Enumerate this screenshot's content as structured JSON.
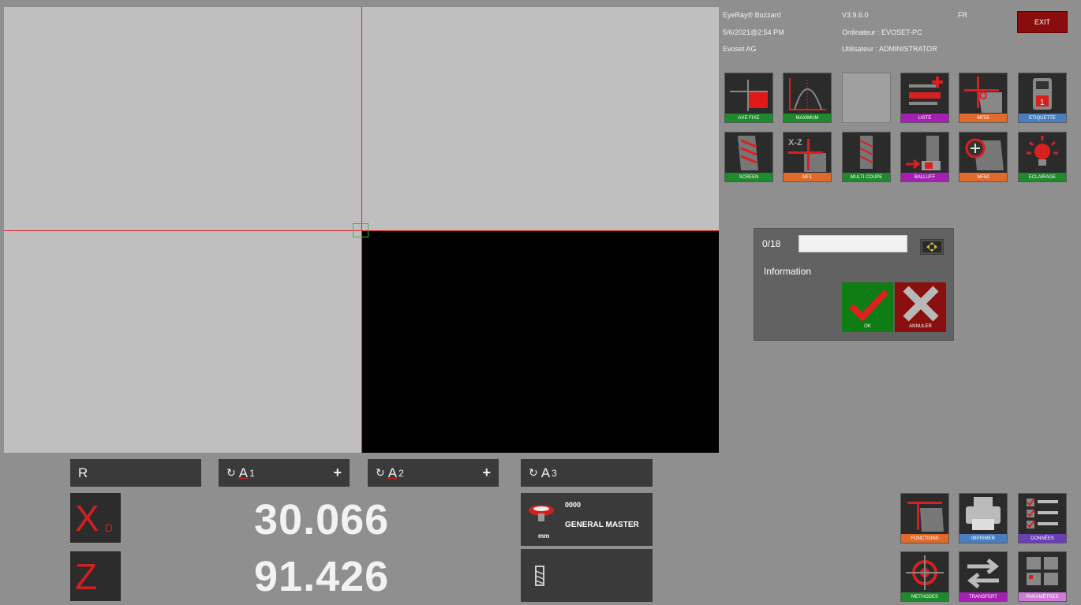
{
  "header": {
    "app_name": "EyeRay® Buzzard",
    "datetime": "5/6/2021@2:54 PM",
    "company": "Evoset AG",
    "version": "V3.9.6.0",
    "computer": "Ordinateur : EVOSET-PC",
    "user": "Utilisateur : ADMINISTRATOR",
    "language": "FR",
    "exit_label": "EXIT"
  },
  "tools_row1": [
    {
      "label": "AXE FIXE",
      "color": "#1d8a2b",
      "icon": "axe-fixe-icon"
    },
    {
      "label": "MAXIMUM",
      "color": "#1d8a2b",
      "icon": "maximum-icon"
    },
    {
      "label": "",
      "color": "",
      "icon": ""
    },
    {
      "label": "LISTE",
      "color": "#a51fb3",
      "icon": "liste-icon"
    },
    {
      "label": "MF55",
      "color": "#e06a2a",
      "icon": "mf55-icon"
    },
    {
      "label": "ETIQUETTE",
      "color": "#4a7fbf",
      "icon": "etiquette-icon"
    }
  ],
  "tools_row2": [
    {
      "label": "SCREEN",
      "color": "#1d8a2b",
      "icon": "screen-icon"
    },
    {
      "label": "MF1",
      "color": "#e06a2a",
      "icon": "mf1-icon"
    },
    {
      "label": "MULTI COUPE",
      "color": "#1d8a2b",
      "icon": "multi-coupe-icon"
    },
    {
      "label": "BALLUFF",
      "color": "#a51fb3",
      "icon": "balluff-icon"
    },
    {
      "label": "MF50",
      "color": "#e06a2a",
      "icon": "mf50-icon"
    },
    {
      "label": "ECLAIRAGE",
      "color": "#1d8a2b",
      "icon": "eclairage-icon"
    }
  ],
  "dialog": {
    "counter": "0/18",
    "input_value": "",
    "info_label": "Information",
    "ok_label": "OK",
    "cancel_label": "ANNULER"
  },
  "dro": {
    "r_label": "R",
    "a1_label": "A",
    "a1_sub": "1",
    "a2_label": "A",
    "a2_sub": "2",
    "a3_label": "A",
    "a3_sub": "3",
    "x_letter": "X",
    "x_sub": "D",
    "x_value": "30.066",
    "z_letter": "Z",
    "z_value": "91.426",
    "tool_number": "0000",
    "tool_name": "GENERAL MASTER",
    "unit": "mm"
  },
  "bottom_buttons": [
    {
      "label": "FONCTIONS",
      "color": "#e06a2a",
      "icon": "fonctions-icon"
    },
    {
      "label": "IMPRIMER",
      "color": "#4a7fbf",
      "icon": "printer-icon"
    },
    {
      "label": "DONNÉES",
      "color": "#6a3fb3",
      "icon": "donnees-icon"
    },
    {
      "label": "METHODES",
      "color": "#1d8a2b",
      "icon": "methodes-icon"
    },
    {
      "label": "TRANSFERT",
      "color": "#a51fb3",
      "icon": "transfert-icon"
    },
    {
      "label": "PARAMÈTRES",
      "color": "#d07ad8",
      "icon": "parametres-icon"
    }
  ]
}
